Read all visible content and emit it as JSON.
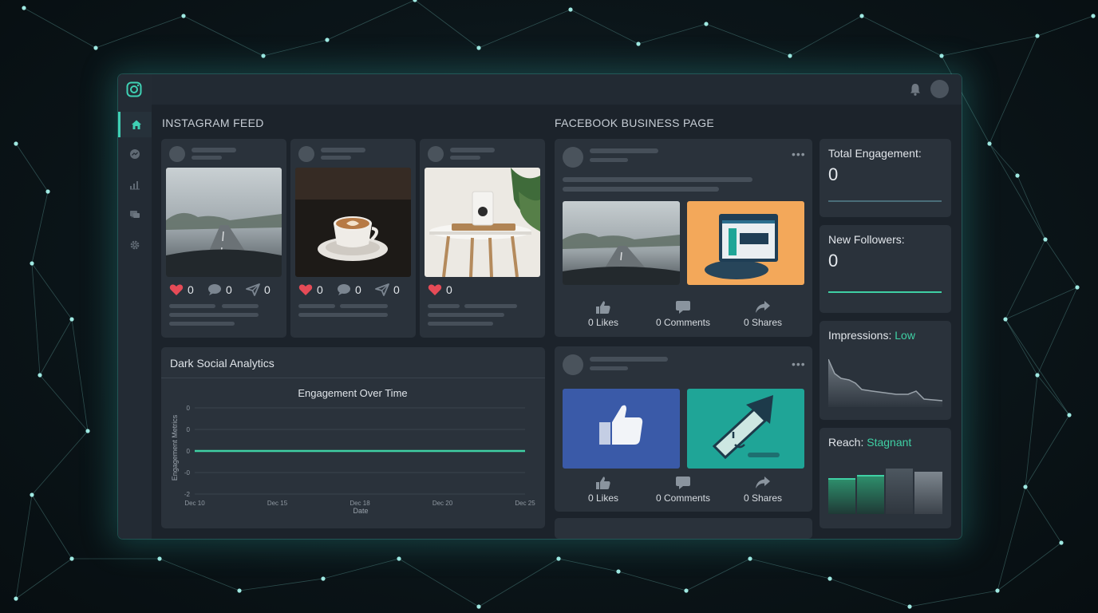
{
  "app": {
    "brand_icon": "instagram-icon"
  },
  "topbar": {
    "icons": [
      "bell-icon",
      "avatar"
    ]
  },
  "sidebar": {
    "items": [
      "home-icon",
      "messenger-icon",
      "bar-chart-icon",
      "chat-icon",
      "gear-icon"
    ],
    "active_index": 0
  },
  "instagram": {
    "title": "INSTAGRAM FEED",
    "posts": [
      {
        "image": "foggy highway through windshield",
        "likes": "0",
        "comments": "0",
        "shares": "0"
      },
      {
        "image": "latte art coffee cup",
        "likes": "0",
        "comments": "0",
        "shares": "0"
      },
      {
        "image": "product jar on side table",
        "likes": "0"
      }
    ]
  },
  "facebook": {
    "title": "FACEBOOK BUSINESS PAGE",
    "posts": [
      {
        "images": [
          "foggy highway",
          "browser window illustration"
        ],
        "likes": "0 Likes",
        "comments": "0 Comments",
        "shares": "0 Shares"
      },
      {
        "images": [
          "thumbs up graphic",
          "broken signpost illustration"
        ],
        "likes": "0 Likes",
        "comments": "0 Comments",
        "shares": "0 Shares"
      }
    ]
  },
  "analytics": {
    "title": "Dark Social Analytics",
    "chart_data": {
      "type": "line",
      "title": "Engagement Over Time",
      "xlabel": "Date",
      "ylabel": "Engagement Metrics",
      "x_ticks": [
        "Dec 10",
        "Dec 15",
        "Dec 18",
        "Dec 20",
        "Dec 25"
      ],
      "y_ticks": [
        "0",
        "0",
        "0",
        "-0",
        "-2"
      ],
      "series": [
        {
          "x": [
            "Dec 10",
            "Dec 25"
          ],
          "values": [
            0,
            0
          ],
          "color": "#3fd0a4"
        }
      ],
      "grid": true
    }
  },
  "metrics": {
    "total_engagement": {
      "label": "Total Engagement:",
      "value": "0"
    },
    "new_followers": {
      "label": "New Followers:",
      "value": "0"
    },
    "impressions": {
      "label": "Impressions:",
      "status": "Low"
    },
    "reach": {
      "label": "Reach:",
      "status": "Stagnant"
    }
  },
  "colors": {
    "accent": "#3fd0a4",
    "like": "#e64b57",
    "background": "#0b1519",
    "panel": "#1c232b",
    "card": "#2a323b"
  }
}
